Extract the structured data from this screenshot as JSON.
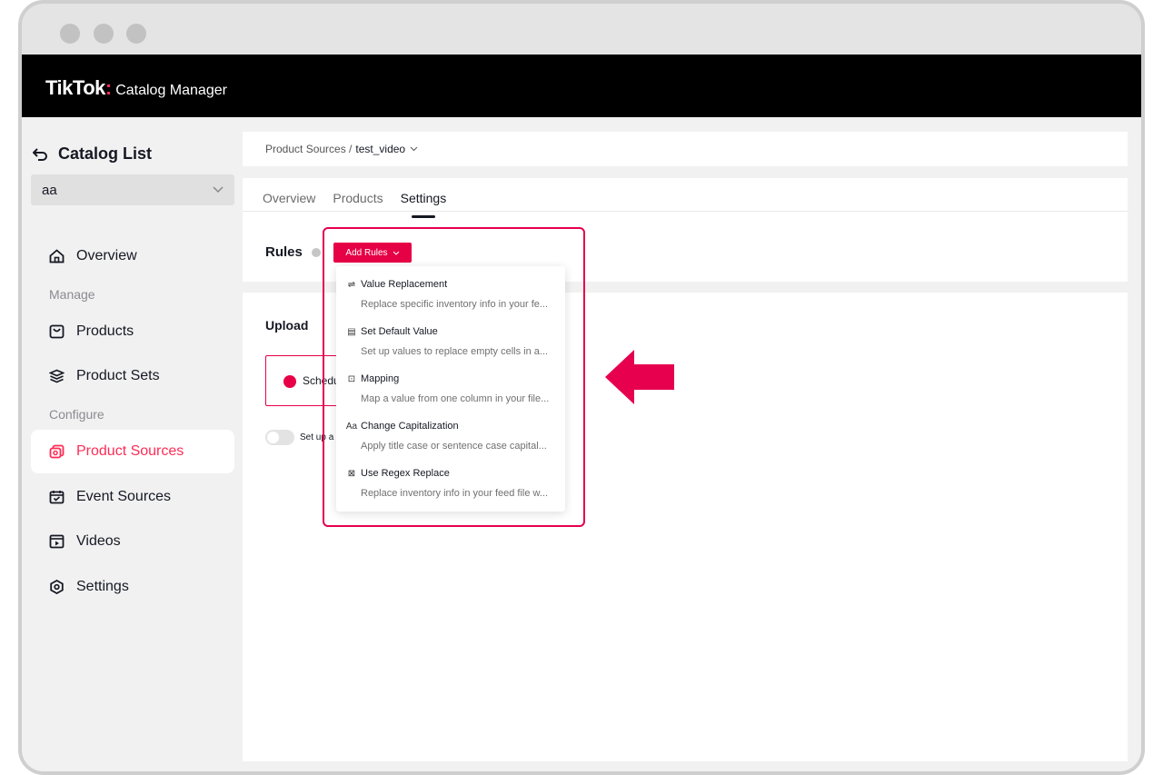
{
  "header": {
    "logo": "TikTok",
    "logo_sep": ":",
    "app_name": "Catalog Manager"
  },
  "sidebar": {
    "back_label": "Catalog List",
    "catalog_select": "aa",
    "overview": "Overview",
    "group_manage": "Manage",
    "products": "Products",
    "product_sets": "Product Sets",
    "group_configure": "Configure",
    "product_sources": "Product Sources",
    "event_sources": "Event Sources",
    "videos": "Videos",
    "settings": "Settings"
  },
  "breadcrumb": {
    "parent": "Product Sources /",
    "current": "test_video"
  },
  "tabs": {
    "overview": "Overview",
    "products": "Products",
    "settings": "Settings"
  },
  "rules": {
    "label": "Rules",
    "add_button": "Add Rules"
  },
  "upload": {
    "title": "Upload",
    "schedule_text": "Schedu",
    "toggle_text": "Set up a"
  },
  "dropdown": [
    {
      "title": "Value Replacement",
      "desc": "Replace specific inventory info in your fe...",
      "icon": "arrows-exchange-icon"
    },
    {
      "title": "Set Default Value",
      "desc": "Set up values to replace empty cells in a...",
      "icon": "table-icon"
    },
    {
      "title": "Mapping",
      "desc": "Map a value from one column in your file...",
      "icon": "mapping-icon"
    },
    {
      "title": "Change Capitalization",
      "desc": "Apply title case or sentence case capital...",
      "icon": "text-case-icon"
    },
    {
      "title": "Use Regex Replace",
      "desc": "Replace inventory info in your feed file w...",
      "icon": "regex-icon"
    }
  ],
  "colors": {
    "accent": "#fe2c55",
    "button": "#e60046",
    "highlight": "#e6004e"
  }
}
